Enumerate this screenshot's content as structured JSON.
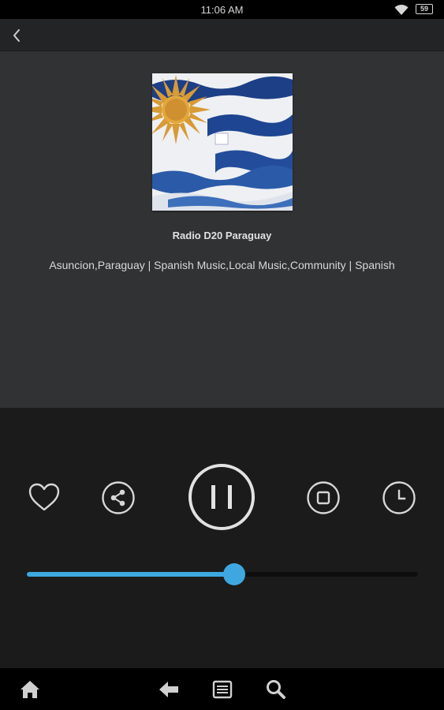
{
  "status_bar": {
    "time": "11:06 AM",
    "battery_icon": "battery-icon",
    "battery_text": "59",
    "wifi_icon": "wifi-icon"
  },
  "top_bar": {
    "back_icon": "chevron-left-icon"
  },
  "station": {
    "cover_art": "uruguay-flag-image",
    "name": "Radio D20 Paraguay",
    "meta": "Asuncion,Paraguay | Spanish Music,Local Music,Community | Spanish"
  },
  "controls": {
    "favorite_icon": "heart-icon",
    "share_icon": "share-icon",
    "pause_icon": "pause-icon",
    "stop_icon": "stop-icon",
    "timer_icon": "clock-icon"
  },
  "seek": {
    "progress_fraction": 0.53,
    "accent_color": "#3ea7e0"
  },
  "nav_bar": {
    "home_icon": "home-icon",
    "back_icon": "back-arrow-icon",
    "menu_icon": "menu-icon",
    "search_icon": "search-icon"
  }
}
